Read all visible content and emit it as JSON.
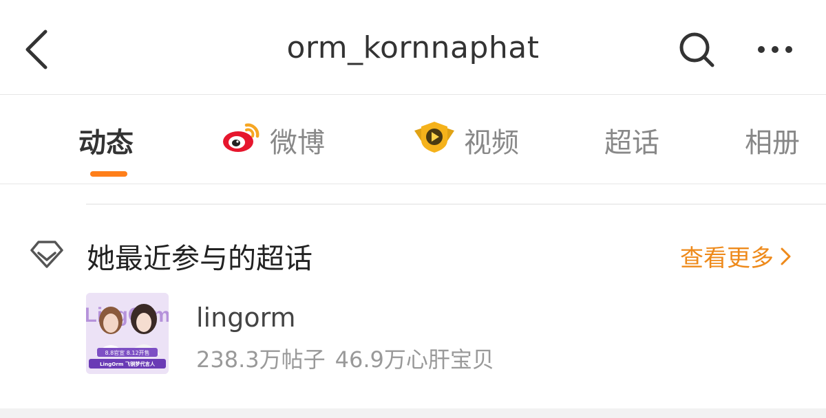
{
  "header": {
    "title": "orm_kornnaphat",
    "back_icon": "chevron-left-icon",
    "search_icon": "search-icon",
    "more_icon": "more-horizontal-icon"
  },
  "tabs": [
    {
      "label": "动态",
      "active": true
    },
    {
      "label": "微博",
      "icon": "weibo-logo-icon"
    },
    {
      "label": "视频",
      "icon": "video-badge-icon"
    },
    {
      "label": "超话"
    },
    {
      "label": "相册"
    }
  ],
  "colors": {
    "accent": "#ff7f1a",
    "link": "#ee8a1b",
    "weibo_red": "#e6162d",
    "weibo_orange": "#f6a623",
    "video_gold": "#f5b21b"
  },
  "section": {
    "icon": "diamond-outline-icon",
    "title": "她最近参与的超话",
    "see_more": "查看更多"
  },
  "topics": [
    {
      "name": "lingorm",
      "posts": "238.3万帖子",
      "fans": "46.9万心肝宝贝",
      "thumbnail": {
        "banner_text": "LingOrm",
        "line1": "8.8官宣 8.12开售",
        "line2": "LingOrm 飞铜梦代言人"
      }
    }
  ]
}
